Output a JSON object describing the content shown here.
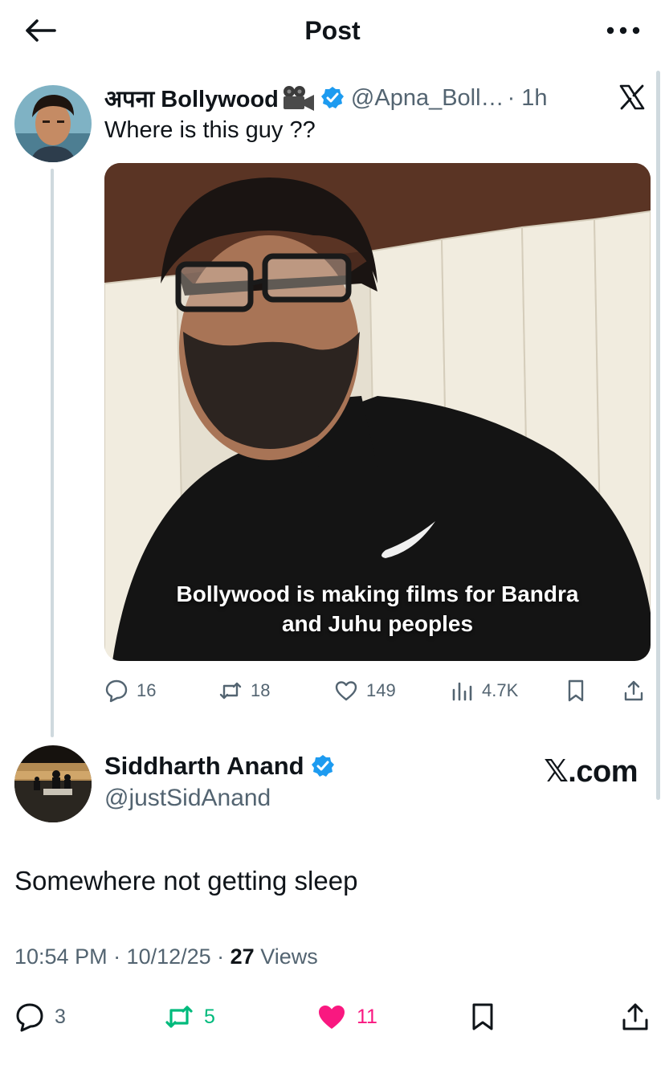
{
  "header": {
    "title": "Post"
  },
  "quoted_post": {
    "author_name": "अपना Bollywood",
    "handle": "@Apna_Boll…",
    "time": "· 1h",
    "text": "Where is this guy ??",
    "image_caption_line1": "Bollywood is making films for Bandra",
    "image_caption_line2": "and Juhu peoples",
    "stats": {
      "replies": "16",
      "reposts": "18",
      "likes": "149",
      "views": "4.7K"
    }
  },
  "post": {
    "author_name": "Siddharth Anand",
    "handle": "@justSidAnand",
    "watermark": "𝕏.com",
    "text": "Somewhere not getting sleep",
    "time": "10:54 PM · 10/12/25 · ",
    "views_count": "27",
    "views_label": " Views",
    "stats": {
      "replies": "3",
      "reposts": "5",
      "likes": "11"
    }
  },
  "colors": {
    "verified": "#1d9bf0",
    "repost_active": "#00ba7c",
    "like_active": "#f91880",
    "muted": "#536471"
  }
}
